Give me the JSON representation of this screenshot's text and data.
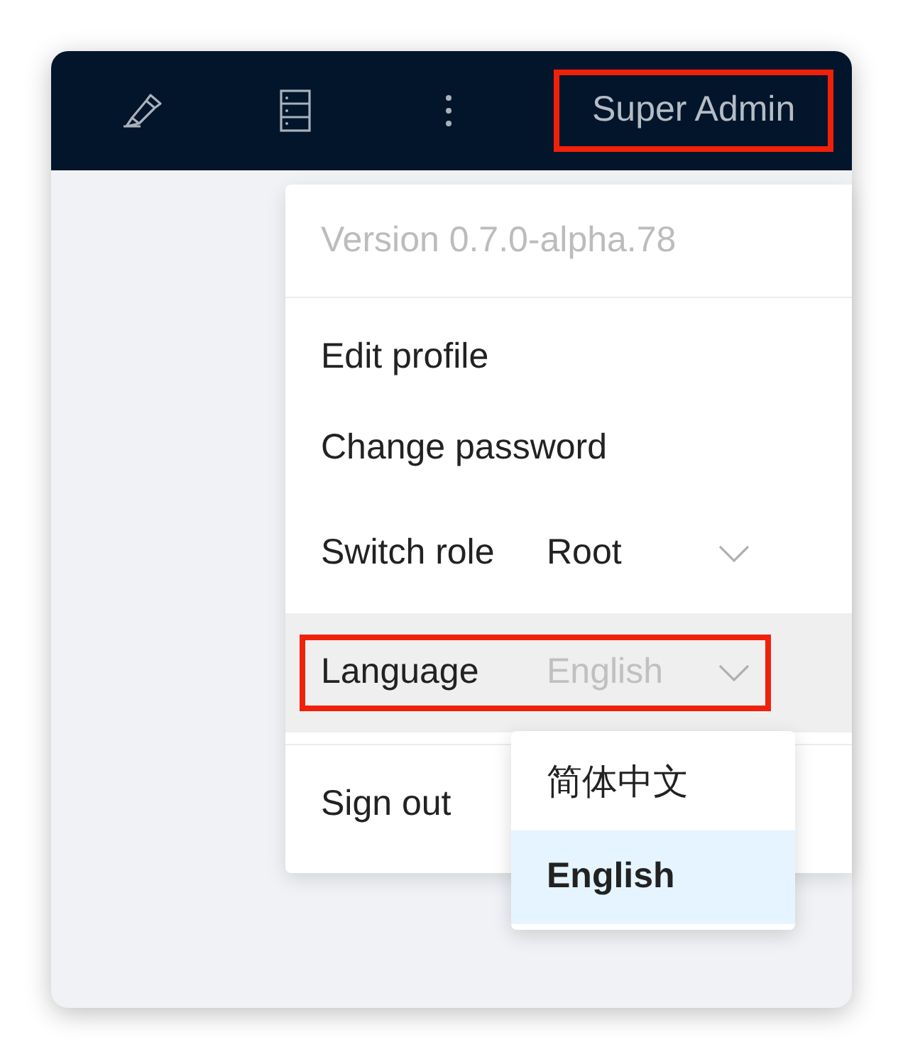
{
  "header": {
    "user": {
      "name": "Super Admin",
      "highlighted": true
    }
  },
  "menu": {
    "version": "Version 0.7.0-alpha.78",
    "items": [
      {
        "kind": "link",
        "label": "Edit profile"
      },
      {
        "kind": "link",
        "label": "Change password"
      },
      {
        "kind": "select",
        "label": "Switch role",
        "value": "Root",
        "muted": false,
        "hovered": false,
        "highlighted": false
      },
      {
        "kind": "select",
        "label": "Language",
        "value": "English",
        "muted": true,
        "hovered": true,
        "highlighted": true
      }
    ],
    "sign_out": "Sign out"
  },
  "language_options": [
    {
      "label": "简体中文",
      "selected": false
    },
    {
      "label": "English",
      "selected": true
    }
  ]
}
